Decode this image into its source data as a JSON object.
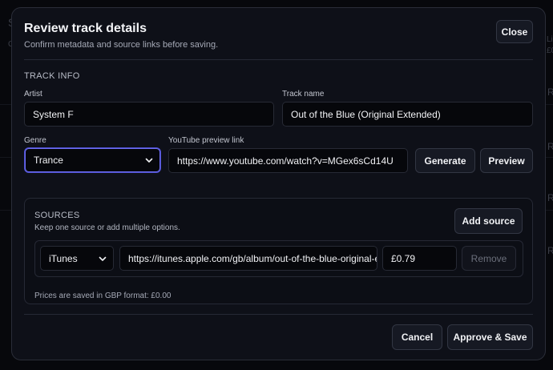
{
  "background": {
    "left_fragments": [
      "S",
      "C"
    ],
    "right_fragments": [
      "Li",
      "£0",
      "R",
      "R",
      "R",
      "R"
    ]
  },
  "modal": {
    "title": "Review track details",
    "subtitle": "Confirm metadata and source links before saving.",
    "close_label": "Close"
  },
  "track_info": {
    "section_title": "TRACK INFO",
    "artist_label": "Artist",
    "artist_value": "System F",
    "track_label": "Track name",
    "track_value": "Out of the Blue (Original Extended)",
    "genre_label": "Genre",
    "genre_value": "Trance",
    "youtube_label": "YouTube preview link",
    "youtube_value": "https://www.youtube.com/watch?v=MGex6sCd14U",
    "generate_label": "Generate",
    "preview_label": "Preview"
  },
  "sources": {
    "section_title": "SOURCES",
    "description": "Keep one source or add multiple options.",
    "add_label": "Add source",
    "items": [
      {
        "store": "iTunes",
        "url": "https://itunes.apple.com/gb/album/out-of-the-blue-original-extended",
        "price": "£0.79",
        "remove_label": "Remove"
      }
    ],
    "price_hint": "Prices are saved in GBP format: £0.00"
  },
  "footer": {
    "cancel_label": "Cancel",
    "approve_label": "Approve & Save"
  },
  "colors": {
    "focus_ring": "#6d6ef2",
    "modal_bg": "#0e1018",
    "input_bg": "#06070b"
  }
}
